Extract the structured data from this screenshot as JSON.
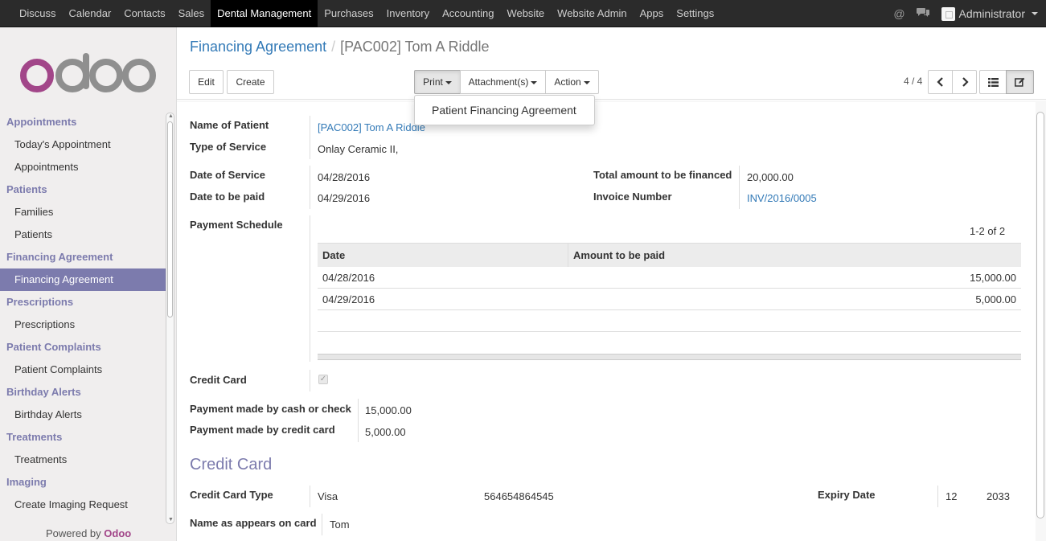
{
  "topbar": {
    "menu": [
      "Discuss",
      "Calendar",
      "Contacts",
      "Sales",
      "Dental Management",
      "Purchases",
      "Inventory",
      "Accounting",
      "Website",
      "Website Admin",
      "Apps",
      "Settings"
    ],
    "active": "Dental Management",
    "user": "Administrator"
  },
  "sidebar": {
    "logo": "odoo",
    "sections": [
      {
        "title": "Appointments",
        "items": [
          "Today's Appointment",
          "Appointments"
        ]
      },
      {
        "title": "Patients",
        "items": [
          "Families",
          "Patients"
        ]
      },
      {
        "title": "Financing Agreement",
        "items": [
          "Financing Agreement"
        ]
      },
      {
        "title": "Prescriptions",
        "items": [
          "Prescriptions"
        ]
      },
      {
        "title": "Patient Complaints",
        "items": [
          "Patient Complaints"
        ]
      },
      {
        "title": "Birthday Alerts",
        "items": [
          "Birthday Alerts"
        ]
      },
      {
        "title": "Treatments",
        "items": [
          "Treatments"
        ]
      },
      {
        "title": "Imaging",
        "items": [
          "Create Imaging Request"
        ]
      }
    ],
    "active_item": "Financing Agreement",
    "powered_by": "Powered by",
    "powered_brand": "Odoo"
  },
  "control_panel": {
    "breadcrumb_parent": "Financing Agreement",
    "breadcrumb_sep": "/",
    "breadcrumb_current": "[PAC002] Tom A Riddle",
    "edit_label": "Edit",
    "create_label": "Create",
    "print_label": "Print",
    "attachments_label": "Attachment(s)",
    "action_label": "Action",
    "pager": "4 / 4",
    "print_menu": [
      "Patient Financing Agreement"
    ]
  },
  "form": {
    "name_of_patient_label": "Name of Patient",
    "name_of_patient": "[PAC002] Tom A Riddle",
    "type_of_service_label": "Type of Service",
    "type_of_service": "Onlay Ceramic II,",
    "date_of_service_label": "Date of Service",
    "date_of_service": "04/28/2016",
    "date_to_be_paid_label": "Date to be paid",
    "date_to_be_paid": "04/29/2016",
    "total_financed_label": "Total amount to be financed",
    "total_financed": "20,000.00",
    "invoice_number_label": "Invoice Number",
    "invoice_number": "INV/2016/0005",
    "payment_schedule_label": "Payment Schedule",
    "schedule_pager": "1-2 of 2",
    "schedule_columns": [
      "Date",
      "Amount to be paid"
    ],
    "schedule_rows": [
      {
        "date": "04/28/2016",
        "amount": "15,000.00"
      },
      {
        "date": "04/29/2016",
        "amount": "5,000.00"
      }
    ],
    "credit_card_label": "Credit Card",
    "credit_card_checked": true,
    "cash_check_label": "Payment made by cash or check",
    "cash_check": "15,000.00",
    "credit_paid_label": "Payment made by credit card",
    "credit_paid": "5,000.00",
    "cc_section_title": "Credit Card",
    "cc_type_label": "Credit Card Type",
    "cc_type": "Visa",
    "cc_number": "564654864545",
    "expiry_label": "Expiry Date",
    "expiry_month": "12",
    "expiry_year": "2033",
    "name_on_card_label": "Name as appears on card",
    "name_on_card": "Tom"
  }
}
